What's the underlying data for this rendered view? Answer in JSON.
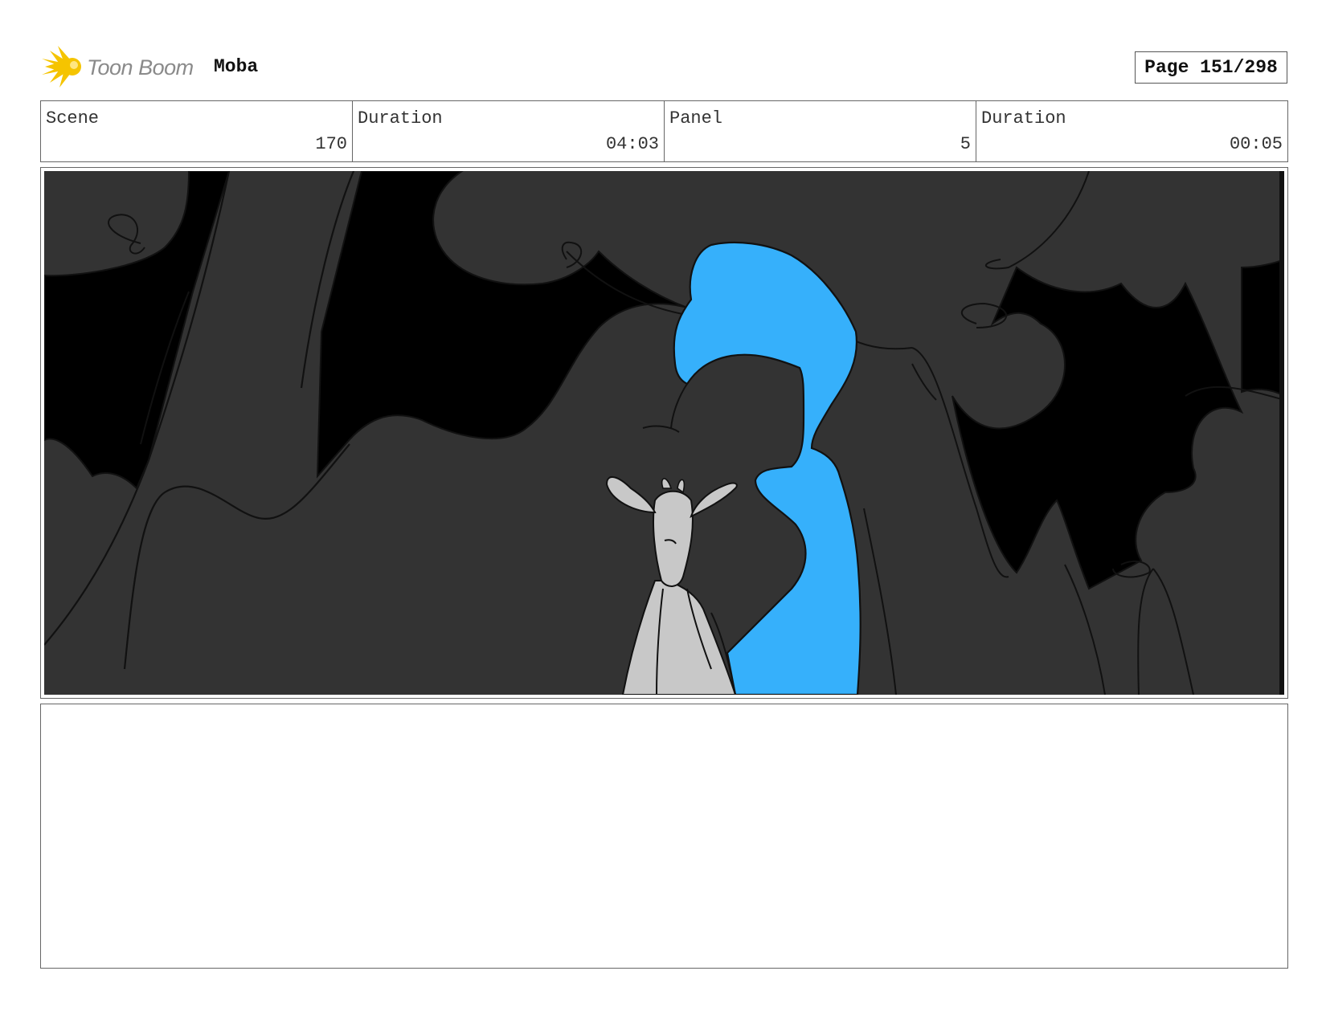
{
  "header": {
    "logo_text": "Toon Boom",
    "project_name": "Moba",
    "page_label": "Page 151/298"
  },
  "info": [
    {
      "label": "Scene",
      "value": "170"
    },
    {
      "label": "Duration",
      "value": "04:03"
    },
    {
      "label": "Panel",
      "value": "5"
    },
    {
      "label": "Duration",
      "value": "00:05"
    }
  ],
  "colors": {
    "logo_accent": "#f5c400",
    "background_dark": "#333333",
    "sky_black": "#000000",
    "hair_blue": "#36b0fb",
    "character_grey": "#c8c8c8"
  },
  "notes": ""
}
